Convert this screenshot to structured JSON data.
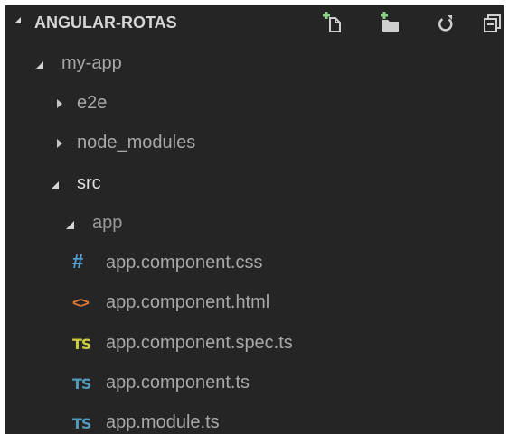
{
  "explorer": {
    "section_title": "ANGULAR-ROTAS",
    "actions": [
      {
        "name": "new-file-icon"
      },
      {
        "name": "new-folder-icon"
      },
      {
        "name": "refresh-icon"
      },
      {
        "name": "collapse-all-icon"
      }
    ],
    "colors": {
      "background": "#252526",
      "text": "#a8a8a8",
      "css_icon": "#4fa3d9",
      "html_icon": "#e37933",
      "spec_ts_icon": "#cbcb41",
      "ts_icon": "#519aba"
    }
  },
  "tree": {
    "my_app": "my-app",
    "e2e": "e2e",
    "node_modules": "node_modules",
    "src": "src",
    "app": "app",
    "files": {
      "css": {
        "icon_text": "#",
        "label": "app.component.css"
      },
      "html": {
        "icon_text": "<>",
        "label": "app.component.html"
      },
      "spec": {
        "icon_text": "TS",
        "label": "app.component.spec.ts"
      },
      "comp_ts": {
        "icon_text": "TS",
        "label": "app.component.ts"
      },
      "module": {
        "icon_text": "TS",
        "label": "app.module.ts"
      }
    }
  }
}
